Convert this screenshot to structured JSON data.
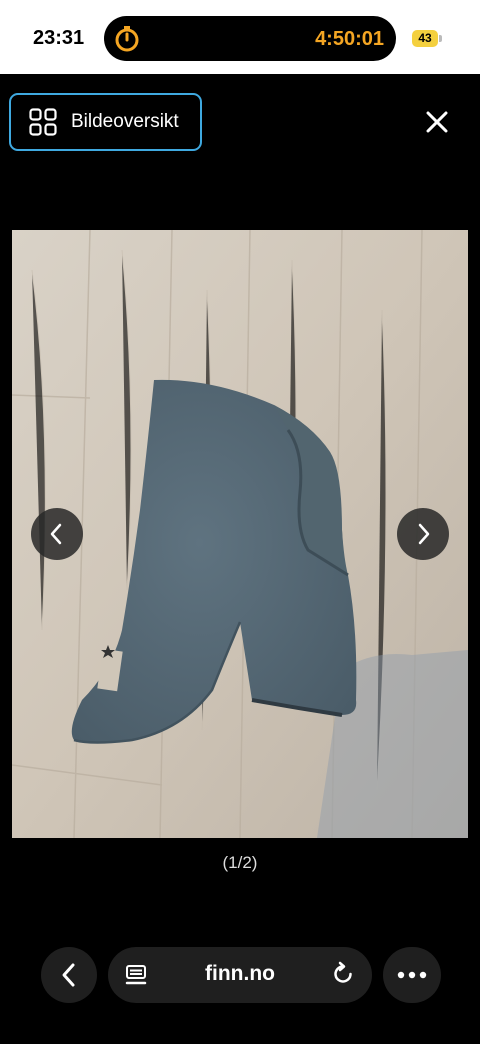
{
  "status_bar": {
    "time": "23:31",
    "timer": "4:50:01",
    "battery": "43"
  },
  "header": {
    "overview_label": "Bildeoversikt",
    "close_icon": "close-icon"
  },
  "gallery": {
    "counter": "(1/2)",
    "prev_icon": "chevron-left-icon",
    "next_icon": "chevron-right-icon"
  },
  "browser": {
    "url": "finn.no",
    "back_icon": "chevron-left-icon",
    "page_icon": "page-menu-icon",
    "reload_icon": "reload-icon",
    "more_icon": "more-icon"
  },
  "colors": {
    "accent": "#3fa9e0",
    "timer": "#f5a623",
    "battery": "#f4d03f"
  }
}
